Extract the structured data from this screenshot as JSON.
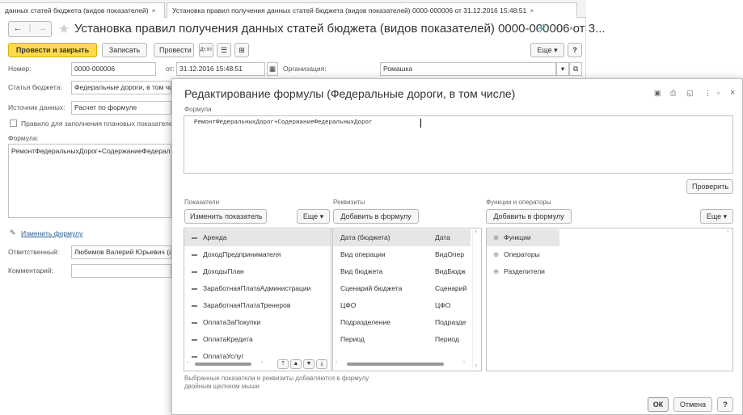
{
  "tabs": [
    {
      "label": "данных статей бюджета (видов показателей)",
      "close": "×"
    },
    {
      "label": "Установка правил получения данных статей бюджета (видов показателей) 0000-000006 от 31.12.2016 15:48:51",
      "close": "×"
    }
  ],
  "nav": {
    "back": "←",
    "forward": "→",
    "star": "★"
  },
  "doc_title": "Установка правил получения данных статей бюджета (видов показателей) 0000-000006 от 3...",
  "header_icons": {
    "link": "🔗",
    "more": "⋮",
    "close": "×"
  },
  "toolbar": {
    "post_close": "Провести и закрыть",
    "save": "Записать",
    "post": "Провести",
    "dt_kt": "Дт Кт",
    "more": "Еще",
    "help": "?"
  },
  "fields": {
    "number_label": "Номер:",
    "number_value": "0000-000006",
    "date_label": "от:",
    "date_value": "31.12.2016 15:48:51",
    "org_label": "Организация:",
    "org_value": "Ромашка",
    "article_label": "Статья бюджета:",
    "article_value": "Федеральные дороги, в том чи",
    "source_label": "Источник данных:",
    "source_value": "Расчет по формуле",
    "plan_rule": "Правило для заполнения плановых показателе",
    "formula_label": "Формула:",
    "formula_value": "РемонтФедеральныхДорог+СодержаниеФедерал",
    "change_formula": "Изменить формулу",
    "responsible_label": "Ответственный:",
    "responsible_value": "Любимов Валерий Юрьевич (а",
    "comment_label": "Комментарий:",
    "comment_value": ""
  },
  "dialog": {
    "title": "Редактирование формулы (Федеральные дороги, в том числе)",
    "formula_section": "Формула",
    "formula_text": "РемонтФедеральныхДорог+СодержаниеФедеральныхДорог",
    "check_btn": "Проверить",
    "indicators_label": "Показатели",
    "change_indicator_btn": "Изменить показатель",
    "more": "Еще",
    "indicators": [
      "Аренда",
      "ДоходПредпринимателя",
      "ДоходыПлан",
      "ЗаработнаяПлатаАдминистрации",
      "ЗаработнаяПлатаТренеров",
      "ОплатаЗаПокупки",
      "ОплатаКредита",
      "ОплатаУслуг"
    ],
    "attributes_label": "Реквизиты",
    "add_to_formula_btn": "Добавить в формулу",
    "attributes": [
      {
        "name": "Дата (бюджета)",
        "code": "Дата"
      },
      {
        "name": "Вид операции",
        "code": "ВидОпер"
      },
      {
        "name": "Вид бюджета",
        "code": "ВидБюдж"
      },
      {
        "name": "Сценарий бюджета",
        "code": "Сценарий"
      },
      {
        "name": "ЦФО",
        "code": "ЦФО"
      },
      {
        "name": "Подразделение",
        "code": "Подразде"
      },
      {
        "name": "Период",
        "code": "Период"
      }
    ],
    "functions_label": "Функции и операторы",
    "functions": [
      "Функции",
      "Операторы",
      "Разделители"
    ],
    "hint": "Выбранные показатели и реквизиты добавляются в формулу двойным щелчком мыши",
    "hint_line1": "Выбранные показатели и реквизиты добавляются в формулу",
    "hint_line2": "двойным щелчком мыши",
    "ok": "ОК",
    "cancel": "Отмена",
    "help": "?"
  }
}
